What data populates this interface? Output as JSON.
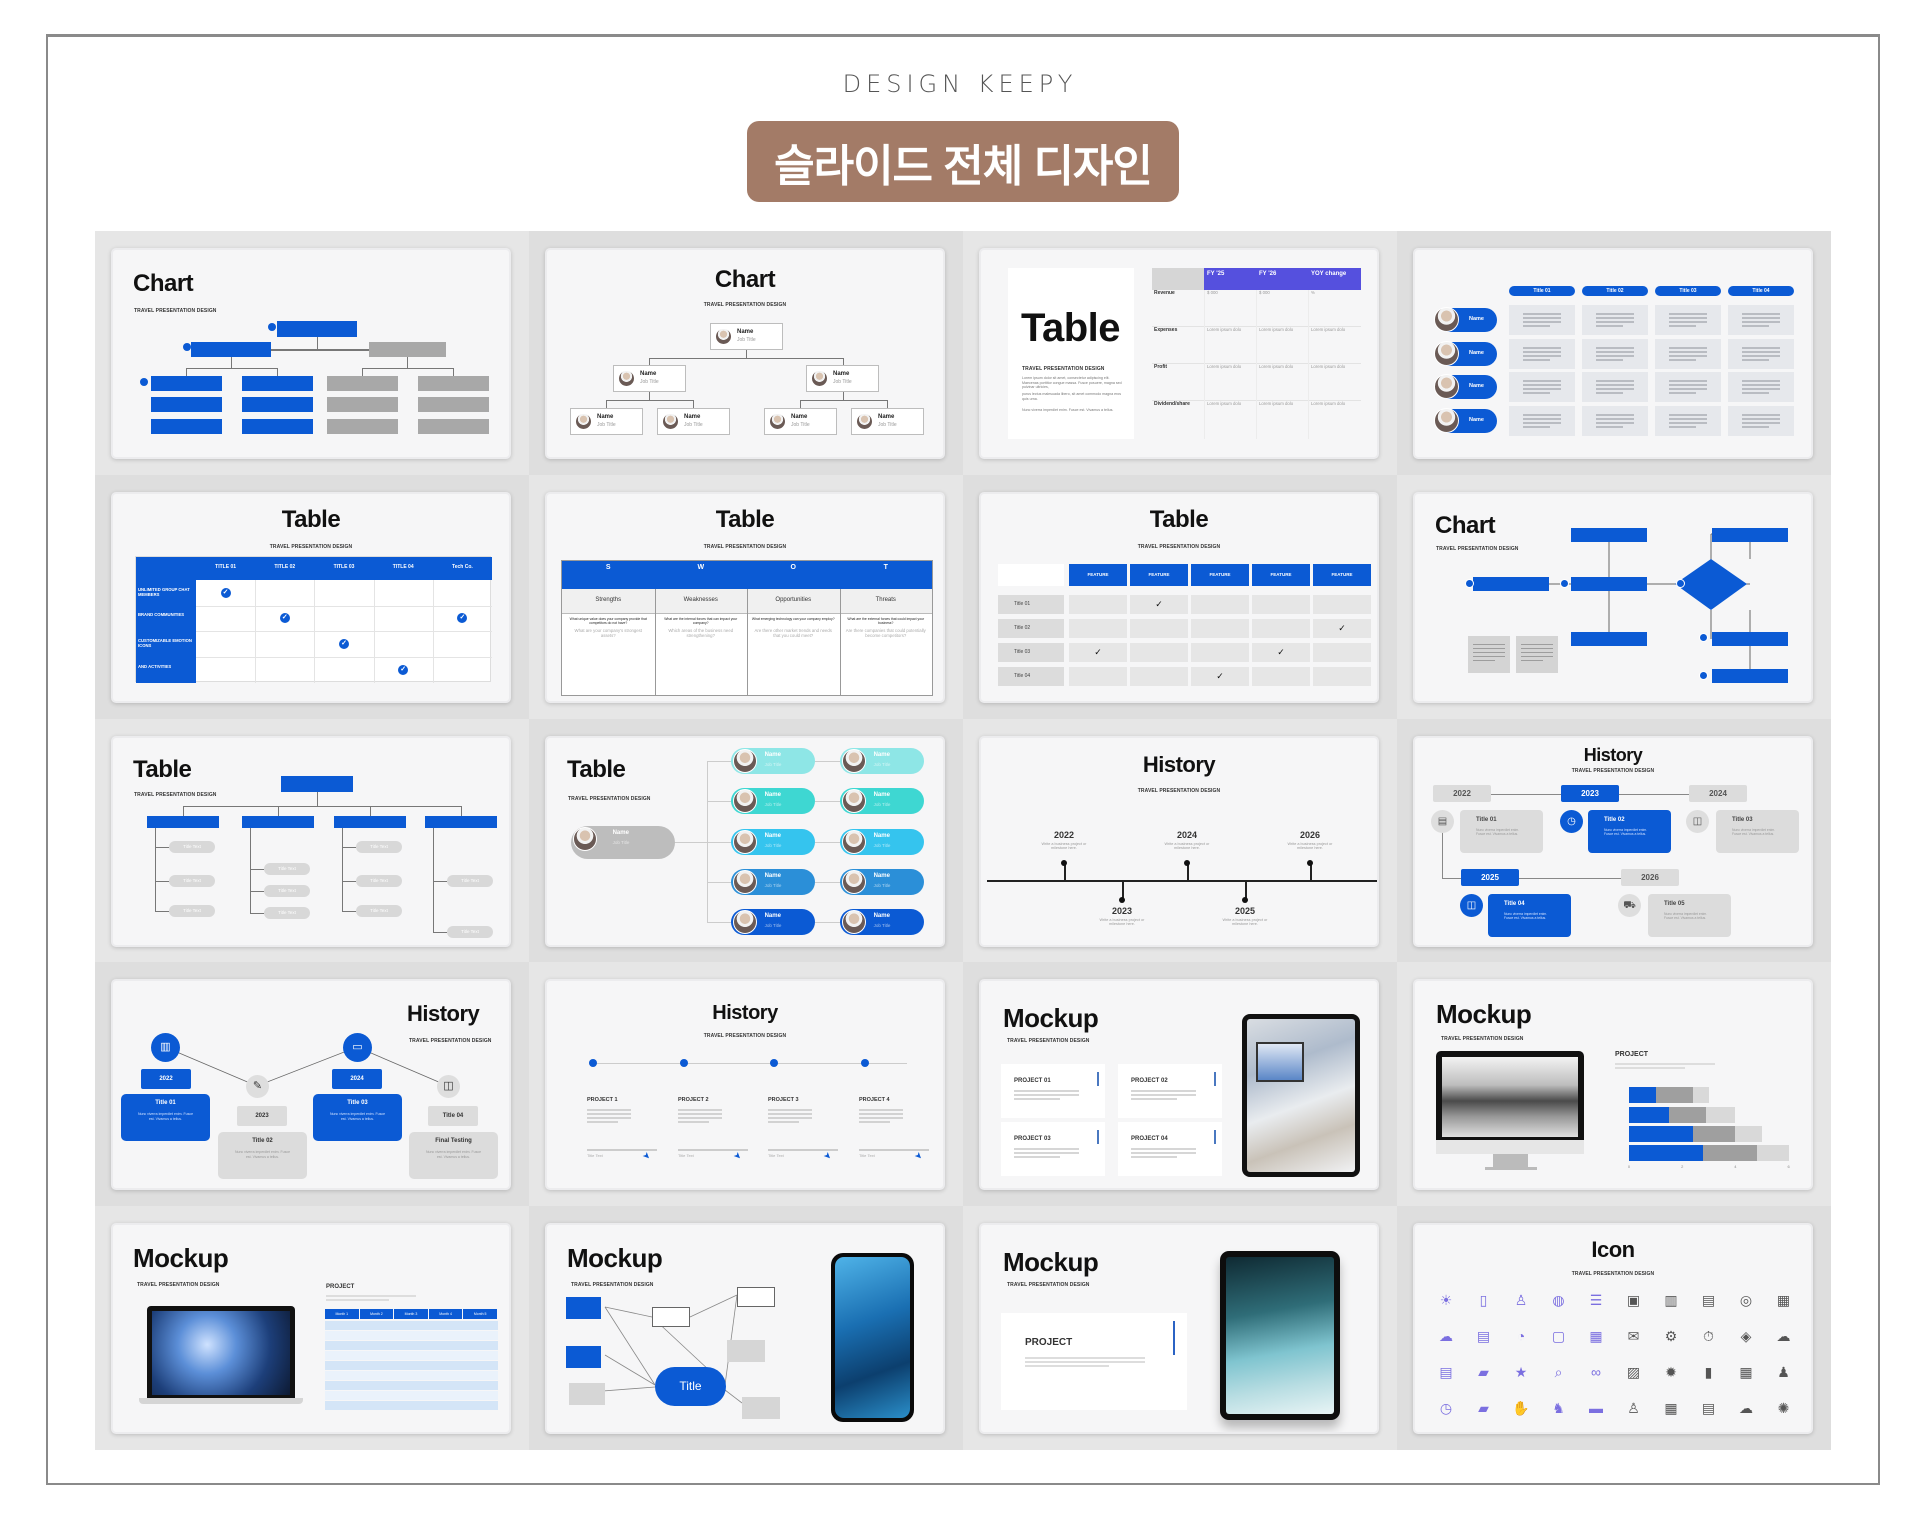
{
  "header": {
    "brand": "DESIGN KEEPY",
    "title": "슬라이드 전체 디자인"
  },
  "subtitle": "TRAVEL PRESENTATION DESIGN",
  "colors": {
    "accent_blue": "#0b5ad4",
    "violet": "#5550de",
    "badge_brown": "#a37b67",
    "grey_box": "#a8a8a8"
  },
  "slides": [
    {
      "title": "Chart"
    },
    {
      "title": "Chart",
      "node": {
        "name": "Name",
        "job": "Job Title"
      }
    },
    {
      "title": "Table",
      "body": [
        "Lorem ipsum dolor sit amet, consectetur adipiscing elit. Maecenas porttitor congue massa. Fusce posuere, magna sed pulvinar ultricies,",
        "purus lectus malesuada libero, sit amet commodo magna eros quis urna.",
        "Nunc viverra imperdiet enim. Fusce est. Vivamus a tellus."
      ],
      "columns": [
        "FY '25",
        "FY '26",
        "YOY change"
      ],
      "rows": [
        {
          "label": "Revenue",
          "values": [
            "$ 000",
            "$ 000",
            "%"
          ]
        },
        {
          "label": "Expenses",
          "values": [
            "Lorem ipsum dolo",
            "Lorem ipsum dolo",
            "Lorem ipsum dolo"
          ]
        },
        {
          "label": "Profit",
          "values": [
            "Lorem ipsum dolo",
            "Lorem ipsum dolo",
            "Lorem ipsum dolo"
          ]
        },
        {
          "label": "Dividend/share",
          "values": [
            "Lorem ipsum dolo",
            "Lorem ipsum dolo",
            "Lorem ipsum dolo"
          ]
        }
      ]
    },
    {
      "columns": [
        "Title 01",
        "Title 02",
        "Title 03",
        "Title 04"
      ],
      "name": "Name"
    },
    {
      "title": "Table",
      "columns": [
        "TITLE 01",
        "TITLE 02",
        "TITLE 03",
        "TITLE 04",
        "Tech Co."
      ],
      "rows": [
        "UNLIMITED GROUP CHAT MEMBERS",
        "BRAND COMMUNITIES",
        "CUSTOMIZABLE EMOTION ICONS",
        "AND ACTIVITIES"
      ],
      "checks": [
        [
          0
        ],
        [
          1,
          4
        ],
        [
          2
        ],
        [
          3
        ]
      ]
    },
    {
      "title": "Table",
      "swot": [
        {
          "letter": "S",
          "name": "Strengths",
          "question": "What unique value does your company provide that competitors do not have?",
          "prompt": "What are your company's strongest assets?"
        },
        {
          "letter": "W",
          "name": "Weaknesses",
          "question": "What are the internal forces that can impact your company?",
          "prompt": "Which areas of the business need strengthening?"
        },
        {
          "letter": "O",
          "name": "Opportunities",
          "question": "What emerging technology can your company employ?",
          "prompt": "Are there other market trends and needs that you could meet?"
        },
        {
          "letter": "T",
          "name": "Threats",
          "question": "What are the external forces that could impact your business?",
          "prompt": "Are there companies that could potentially become competitors?"
        }
      ]
    },
    {
      "title": "Table",
      "columns": [
        "FEATURE",
        "FEATURE",
        "FEATURE",
        "FEATURE",
        "FEATURE"
      ],
      "rows": [
        "Title 01",
        "Title 02",
        "Title 03",
        "Title 04"
      ],
      "checks": [
        [
          1
        ],
        [
          4
        ],
        [
          0,
          3
        ],
        [
          2
        ]
      ]
    },
    {
      "title": "Chart"
    },
    {
      "title": "Table",
      "item": "Title Text"
    },
    {
      "title": "Table",
      "node": {
        "name": "Name",
        "job": "Job Title"
      }
    },
    {
      "title": "History",
      "events": [
        {
          "year": "2022",
          "text": "Write a business project or milestone here."
        },
        {
          "year": "2023",
          "text": "Write a business project or milestone here."
        },
        {
          "year": "2024",
          "text": "Write a business project or milestone here."
        },
        {
          "year": "2025",
          "text": "Write a business project or milestone here."
        },
        {
          "year": "2026",
          "text": "Write a business project or milestone here."
        }
      ]
    },
    {
      "title": "History",
      "body": "Nunc viverra imperdiet enim. Fusce est. Vivamus a tellus.",
      "events": [
        {
          "year": "2022",
          "title": "Title 01"
        },
        {
          "year": "2023",
          "title": "Title 02"
        },
        {
          "year": "2024",
          "title": "Title 03"
        },
        {
          "year": "2025",
          "title": "Title 04"
        },
        {
          "year": "2026",
          "title": "Title 05"
        }
      ]
    },
    {
      "title": "History",
      "body": "Nunc viverra imperdiet enim. Fusce est. Vivamus a tellus.",
      "steps": [
        {
          "label": "2022",
          "title": "Title 01"
        },
        {
          "label": "2023",
          "title": "Title 02"
        },
        {
          "label": "2024",
          "title": "Title 03"
        },
        {
          "label": "Title 04",
          "title": "Final Testing"
        }
      ]
    },
    {
      "title": "History",
      "projects": [
        "PROJECT 1",
        "PROJECT 2",
        "PROJECT 3",
        "PROJECT 4"
      ],
      "item": "Title Text"
    },
    {
      "title": "Mockup",
      "projects": [
        "PROJECT 01",
        "PROJECT 02",
        "PROJECT 03",
        "PROJECT 04"
      ]
    },
    {
      "title": "Mockup",
      "project": "PROJECT",
      "chart": {
        "type": "bar",
        "stacked": true,
        "orientation": "horizontal",
        "axis_ticks": [
          "0",
          "2",
          "4",
          "6"
        ],
        "xlim": [
          0,
          6
        ],
        "series": [
          [
            1,
            1.4,
            0.6
          ],
          [
            1.5,
            1.4,
            1.1
          ],
          [
            2.4,
            1.6,
            1.0
          ],
          [
            2.8,
            2.0,
            1.2
          ]
        ]
      }
    },
    {
      "title": "Mockup",
      "project": "PROJECT",
      "months": [
        "Month 1",
        "Month 2",
        "Month 3",
        "Month 4",
        "Month 5"
      ]
    },
    {
      "title": "Mockup",
      "center": "Title"
    },
    {
      "title": "Mockup",
      "project": "PROJECT"
    },
    {
      "title": "Icon"
    }
  ]
}
